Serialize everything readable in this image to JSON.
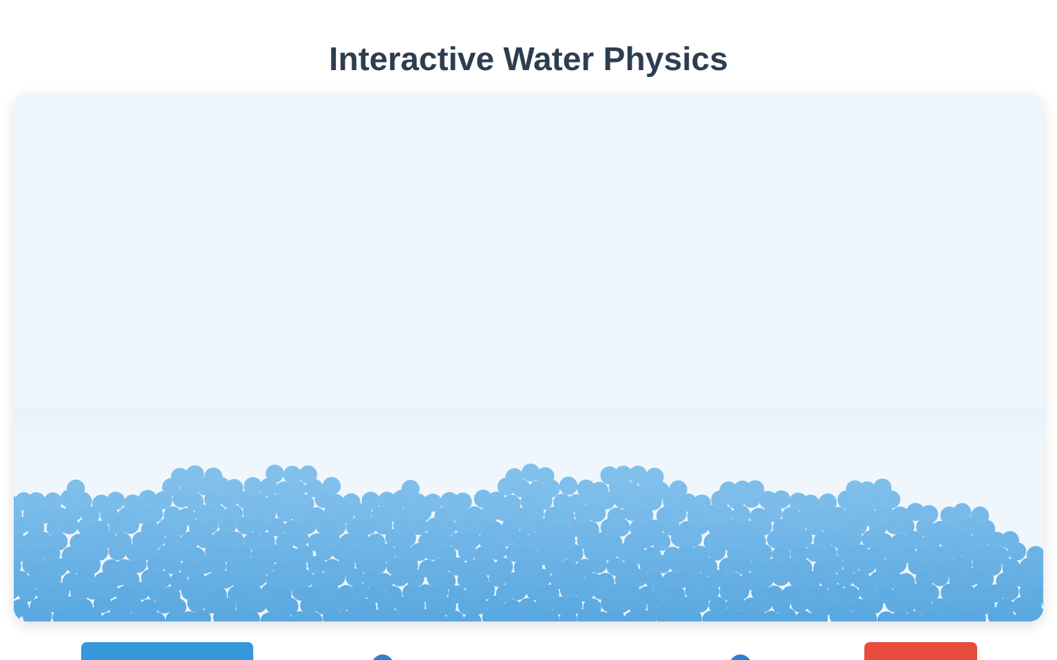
{
  "title": "Interactive Water Physics",
  "controls": [
    {
      "kind": "button",
      "color": "#3498db"
    },
    {
      "kind": "slider",
      "level": 0.5
    },
    {
      "kind": "slider",
      "level": 0.5
    },
    {
      "kind": "button",
      "color": "#e74c3c"
    }
  ]
}
